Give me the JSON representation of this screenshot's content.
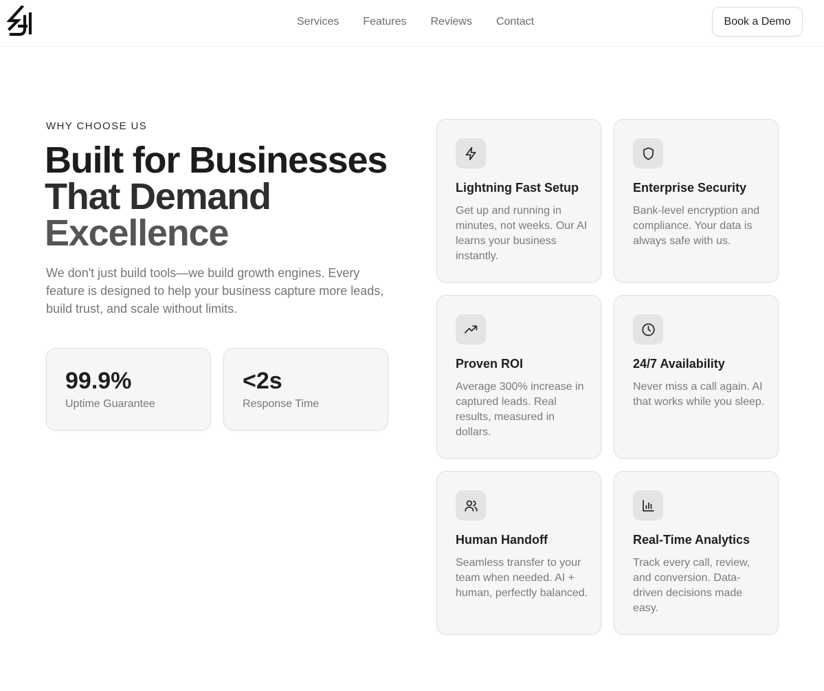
{
  "header": {
    "logo_icon": "brand-logo-icon",
    "nav": [
      {
        "label": "Services"
      },
      {
        "label": "Features"
      },
      {
        "label": "Reviews"
      },
      {
        "label": "Contact"
      }
    ],
    "cta_label": "Book a Demo"
  },
  "hero": {
    "eyebrow": "WHY CHOOSE US",
    "headline": {
      "line1": "Built for Businesses",
      "line2": "That Demand",
      "line3": "Excellence"
    },
    "lead": "We don't just build tools—we build growth engines. Every feature is designed to help your business capture more leads, build trust, and scale without limits."
  },
  "stats": [
    {
      "value": "99.9%",
      "label": "Uptime Guarantee"
    },
    {
      "value": "<2s",
      "label": "Response Time"
    }
  ],
  "features": [
    {
      "icon": "lightning-icon",
      "title": "Lightning Fast Setup",
      "description": "Get up and running in minutes, not weeks. Our AI learns your business instantly."
    },
    {
      "icon": "shield-icon",
      "title": "Enterprise Security",
      "description": "Bank-level encryption and compliance. Your data is always safe with us."
    },
    {
      "icon": "trending-up-icon",
      "title": "Proven ROI",
      "description": "Average 300% increase in captured leads. Real results, measured in dollars."
    },
    {
      "icon": "clock-icon",
      "title": "24/7 Availability",
      "description": "Never miss a call again. AI that works while you sleep."
    },
    {
      "icon": "users-icon",
      "title": "Human Handoff",
      "description": "Seamless transfer to your team when needed. AI + human, perfectly balanced."
    },
    {
      "icon": "bar-chart-icon",
      "title": "Real-Time Analytics",
      "description": "Track every call, review, and conversion. Data-driven decisions made easy."
    }
  ],
  "colors": {
    "background": "#ffffff",
    "card_background": "#f6f6f6",
    "icon_tile": "#e4e4e4",
    "text_primary": "#1f1f1f",
    "text_muted": "#777777"
  }
}
